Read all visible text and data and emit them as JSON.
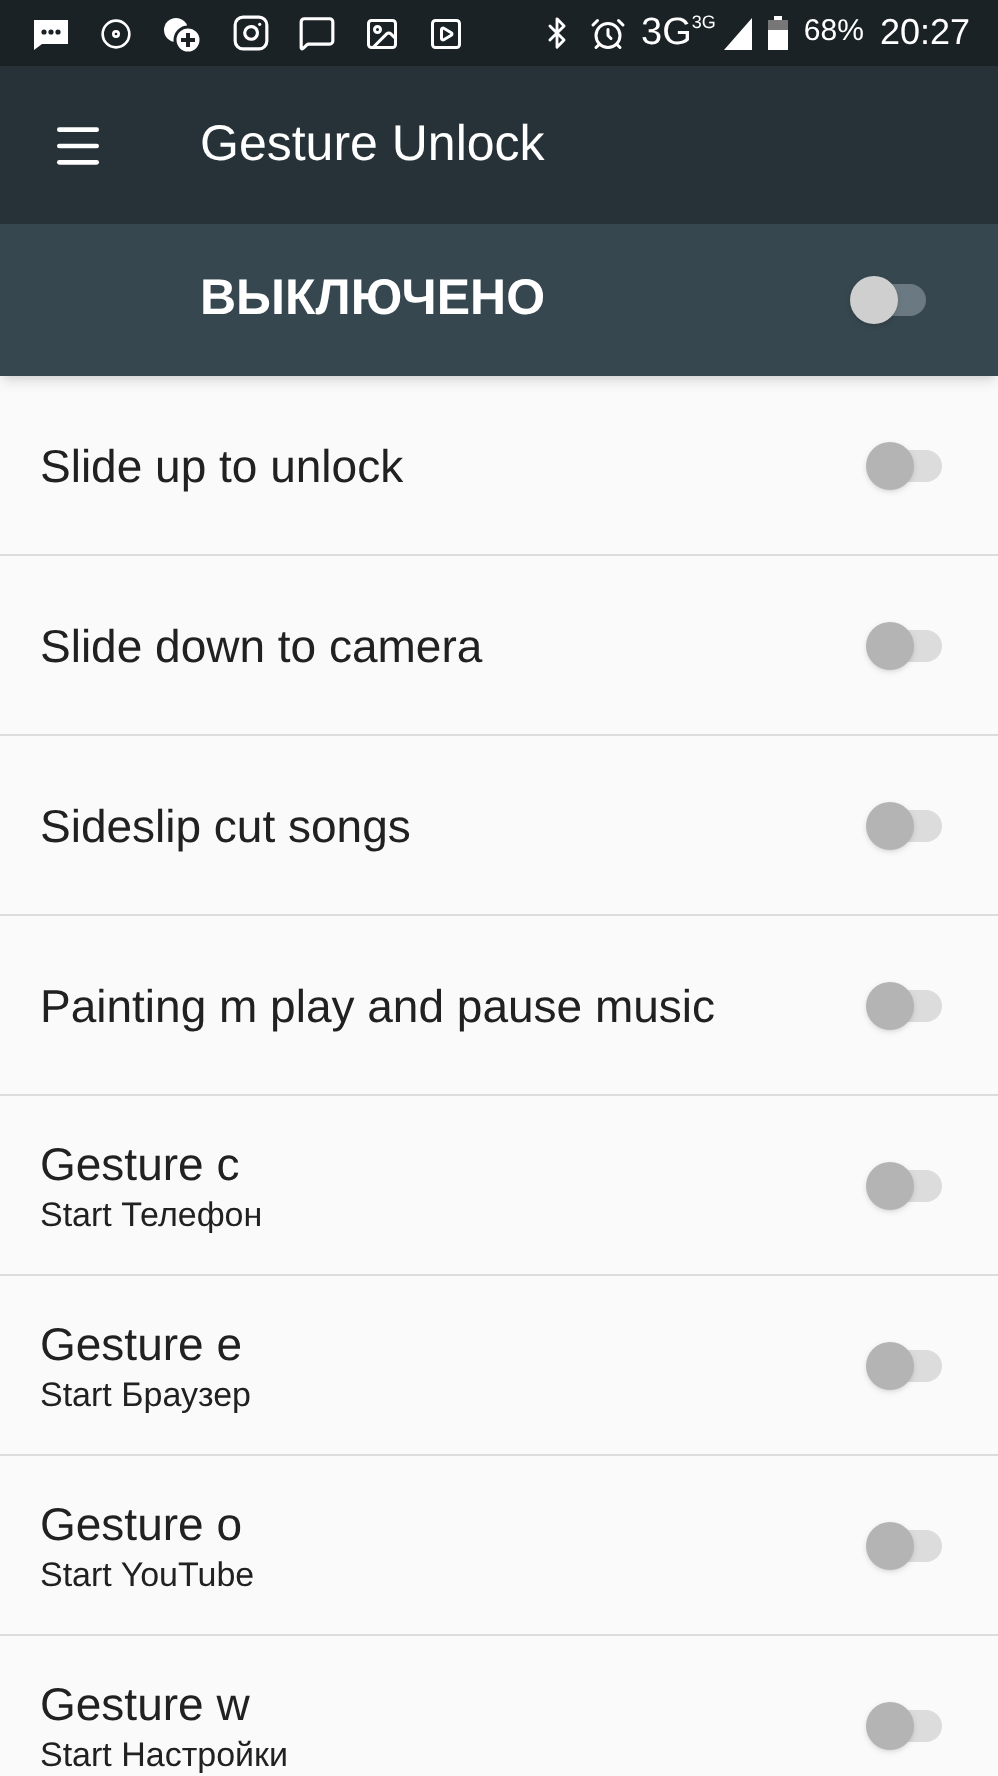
{
  "status_bar": {
    "network": "3G",
    "network_badge": "3G",
    "battery": "68%",
    "time": "20:27"
  },
  "app_bar": {
    "title": "Gesture Unlock"
  },
  "master": {
    "label": "ВЫКЛЮЧЕНО",
    "on": false
  },
  "settings": [
    {
      "title": "Slide up to unlock",
      "on": false
    },
    {
      "title": "Slide down to camera",
      "on": false
    },
    {
      "title": "Sideslip cut songs",
      "on": false
    },
    {
      "title": "Painting m play and pause music",
      "on": false
    },
    {
      "title": "Gesture c",
      "subtitle": "Start Телефон",
      "on": false
    },
    {
      "title": "Gesture e",
      "subtitle": "Start Браузер",
      "on": false
    },
    {
      "title": "Gesture o",
      "subtitle": "Start YouTube",
      "on": false
    },
    {
      "title": "Gesture w",
      "subtitle": "Start Настройки",
      "on": false
    }
  ]
}
